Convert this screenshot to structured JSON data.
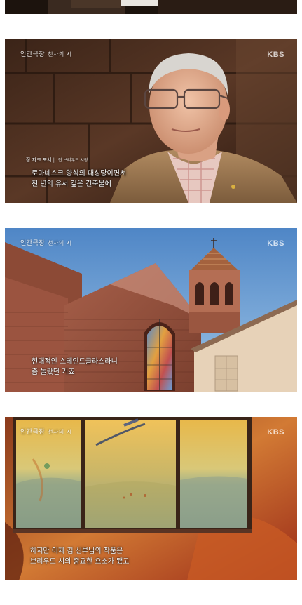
{
  "program": {
    "logo": "인간극장",
    "subtitle": "천사의 시",
    "broadcaster": "KBS"
  },
  "frame1": {
    "speaker_name": "장 자크 포세",
    "speaker_role": "전 브리우드 시장",
    "caption_lines": [
      "로마네스크 양식의 대성당이면서",
      "천 년의 유서 깊은 건축물에"
    ]
  },
  "frame2": {
    "caption_lines": [
      "현대적인 스테인드글라스라니",
      "좀 놀랐던 거죠"
    ]
  },
  "frame3": {
    "caption_lines": [
      "하지만 이제 김 신부님의 작품은",
      "브리우드 시의 중요한 요소가 됐고"
    ]
  }
}
